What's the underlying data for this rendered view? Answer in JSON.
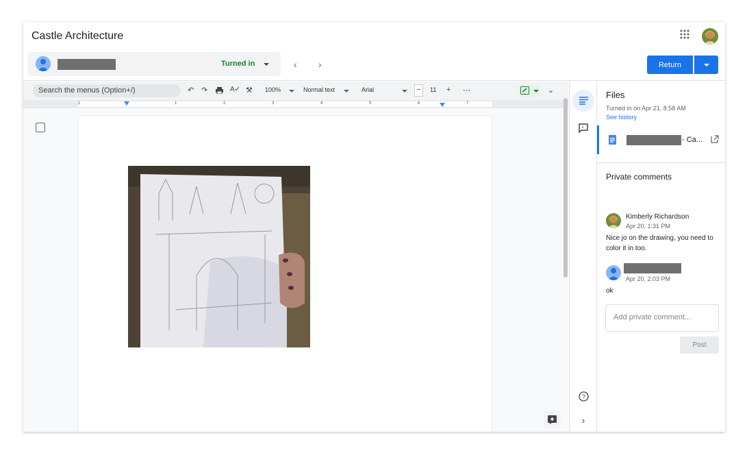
{
  "title": "Castle Architecture",
  "student": {
    "status": "Turned in"
  },
  "actions": {
    "return_label": "Return"
  },
  "toolbar": {
    "search_placeholder": "Search the menus (Option+/)",
    "zoom": "100%",
    "style": "Normal text",
    "font": "Arial",
    "font_size": "11"
  },
  "ruler": {
    "ticks": [
      "1",
      "1",
      "2",
      "3",
      "4",
      "5",
      "6",
      "7"
    ]
  },
  "files": {
    "title": "Files",
    "turned_in": "Turned in on Apr 21, 8:58 AM",
    "see_history": "See history",
    "file_suffix": "- Ca..."
  },
  "comments": {
    "title": "Private comments",
    "items": [
      {
        "author": "Kimberly Richardson",
        "date": "Apr 20, 1:31 PM",
        "text": "Nice jo on the drawing, you need to color it in too."
      },
      {
        "author": "",
        "date": "Apr 20, 2:03 PM",
        "text": "ok"
      }
    ],
    "input_placeholder": "Add private comment...",
    "post_label": "Post"
  },
  "colors": {
    "accent": "#1a73e8",
    "status_green": "#188038"
  }
}
